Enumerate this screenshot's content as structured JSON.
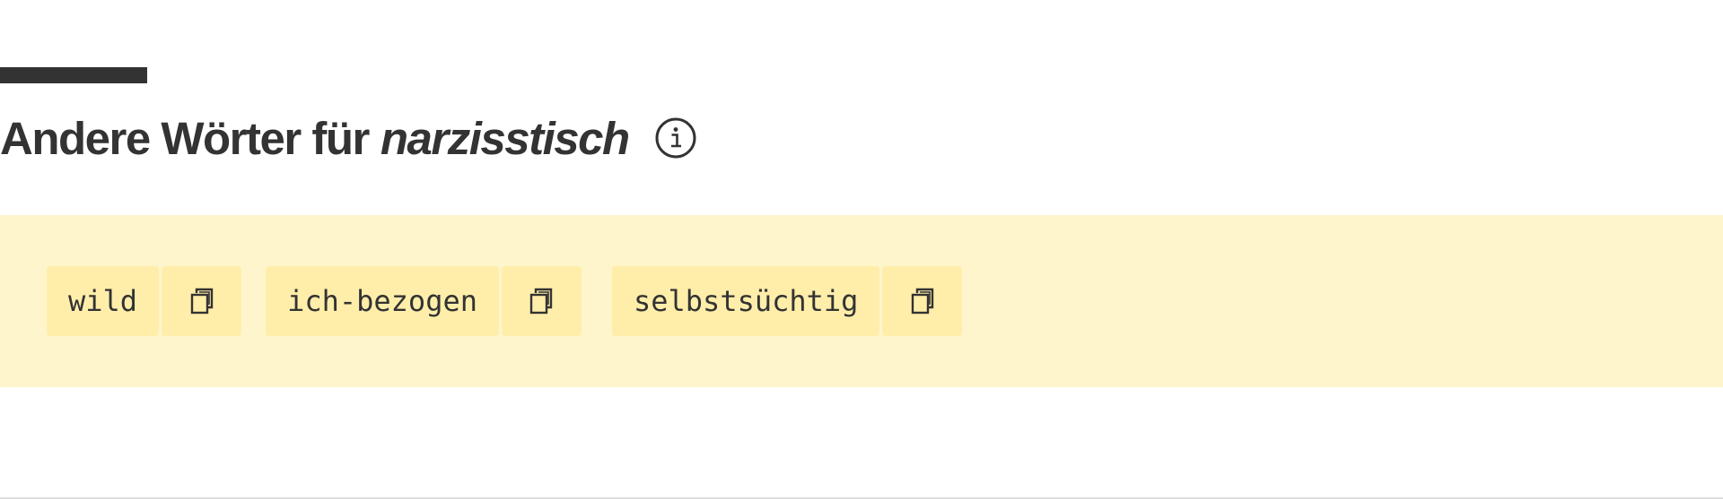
{
  "section": {
    "title_prefix": "Andere Wörter für",
    "title_word": "narzisstisch",
    "info_icon": "info-circle-icon"
  },
  "synonyms": [
    {
      "word": "wild",
      "copy_icon": "copy-icon"
    },
    {
      "word": "ich-bezogen",
      "copy_icon": "copy-icon"
    },
    {
      "word": "selbstsüchtig",
      "copy_icon": "copy-icon"
    }
  ],
  "colors": {
    "text": "#333333",
    "band_background": "#fff5cc",
    "chip_background": "#ffeeaa",
    "accent_bar": "#333333"
  }
}
